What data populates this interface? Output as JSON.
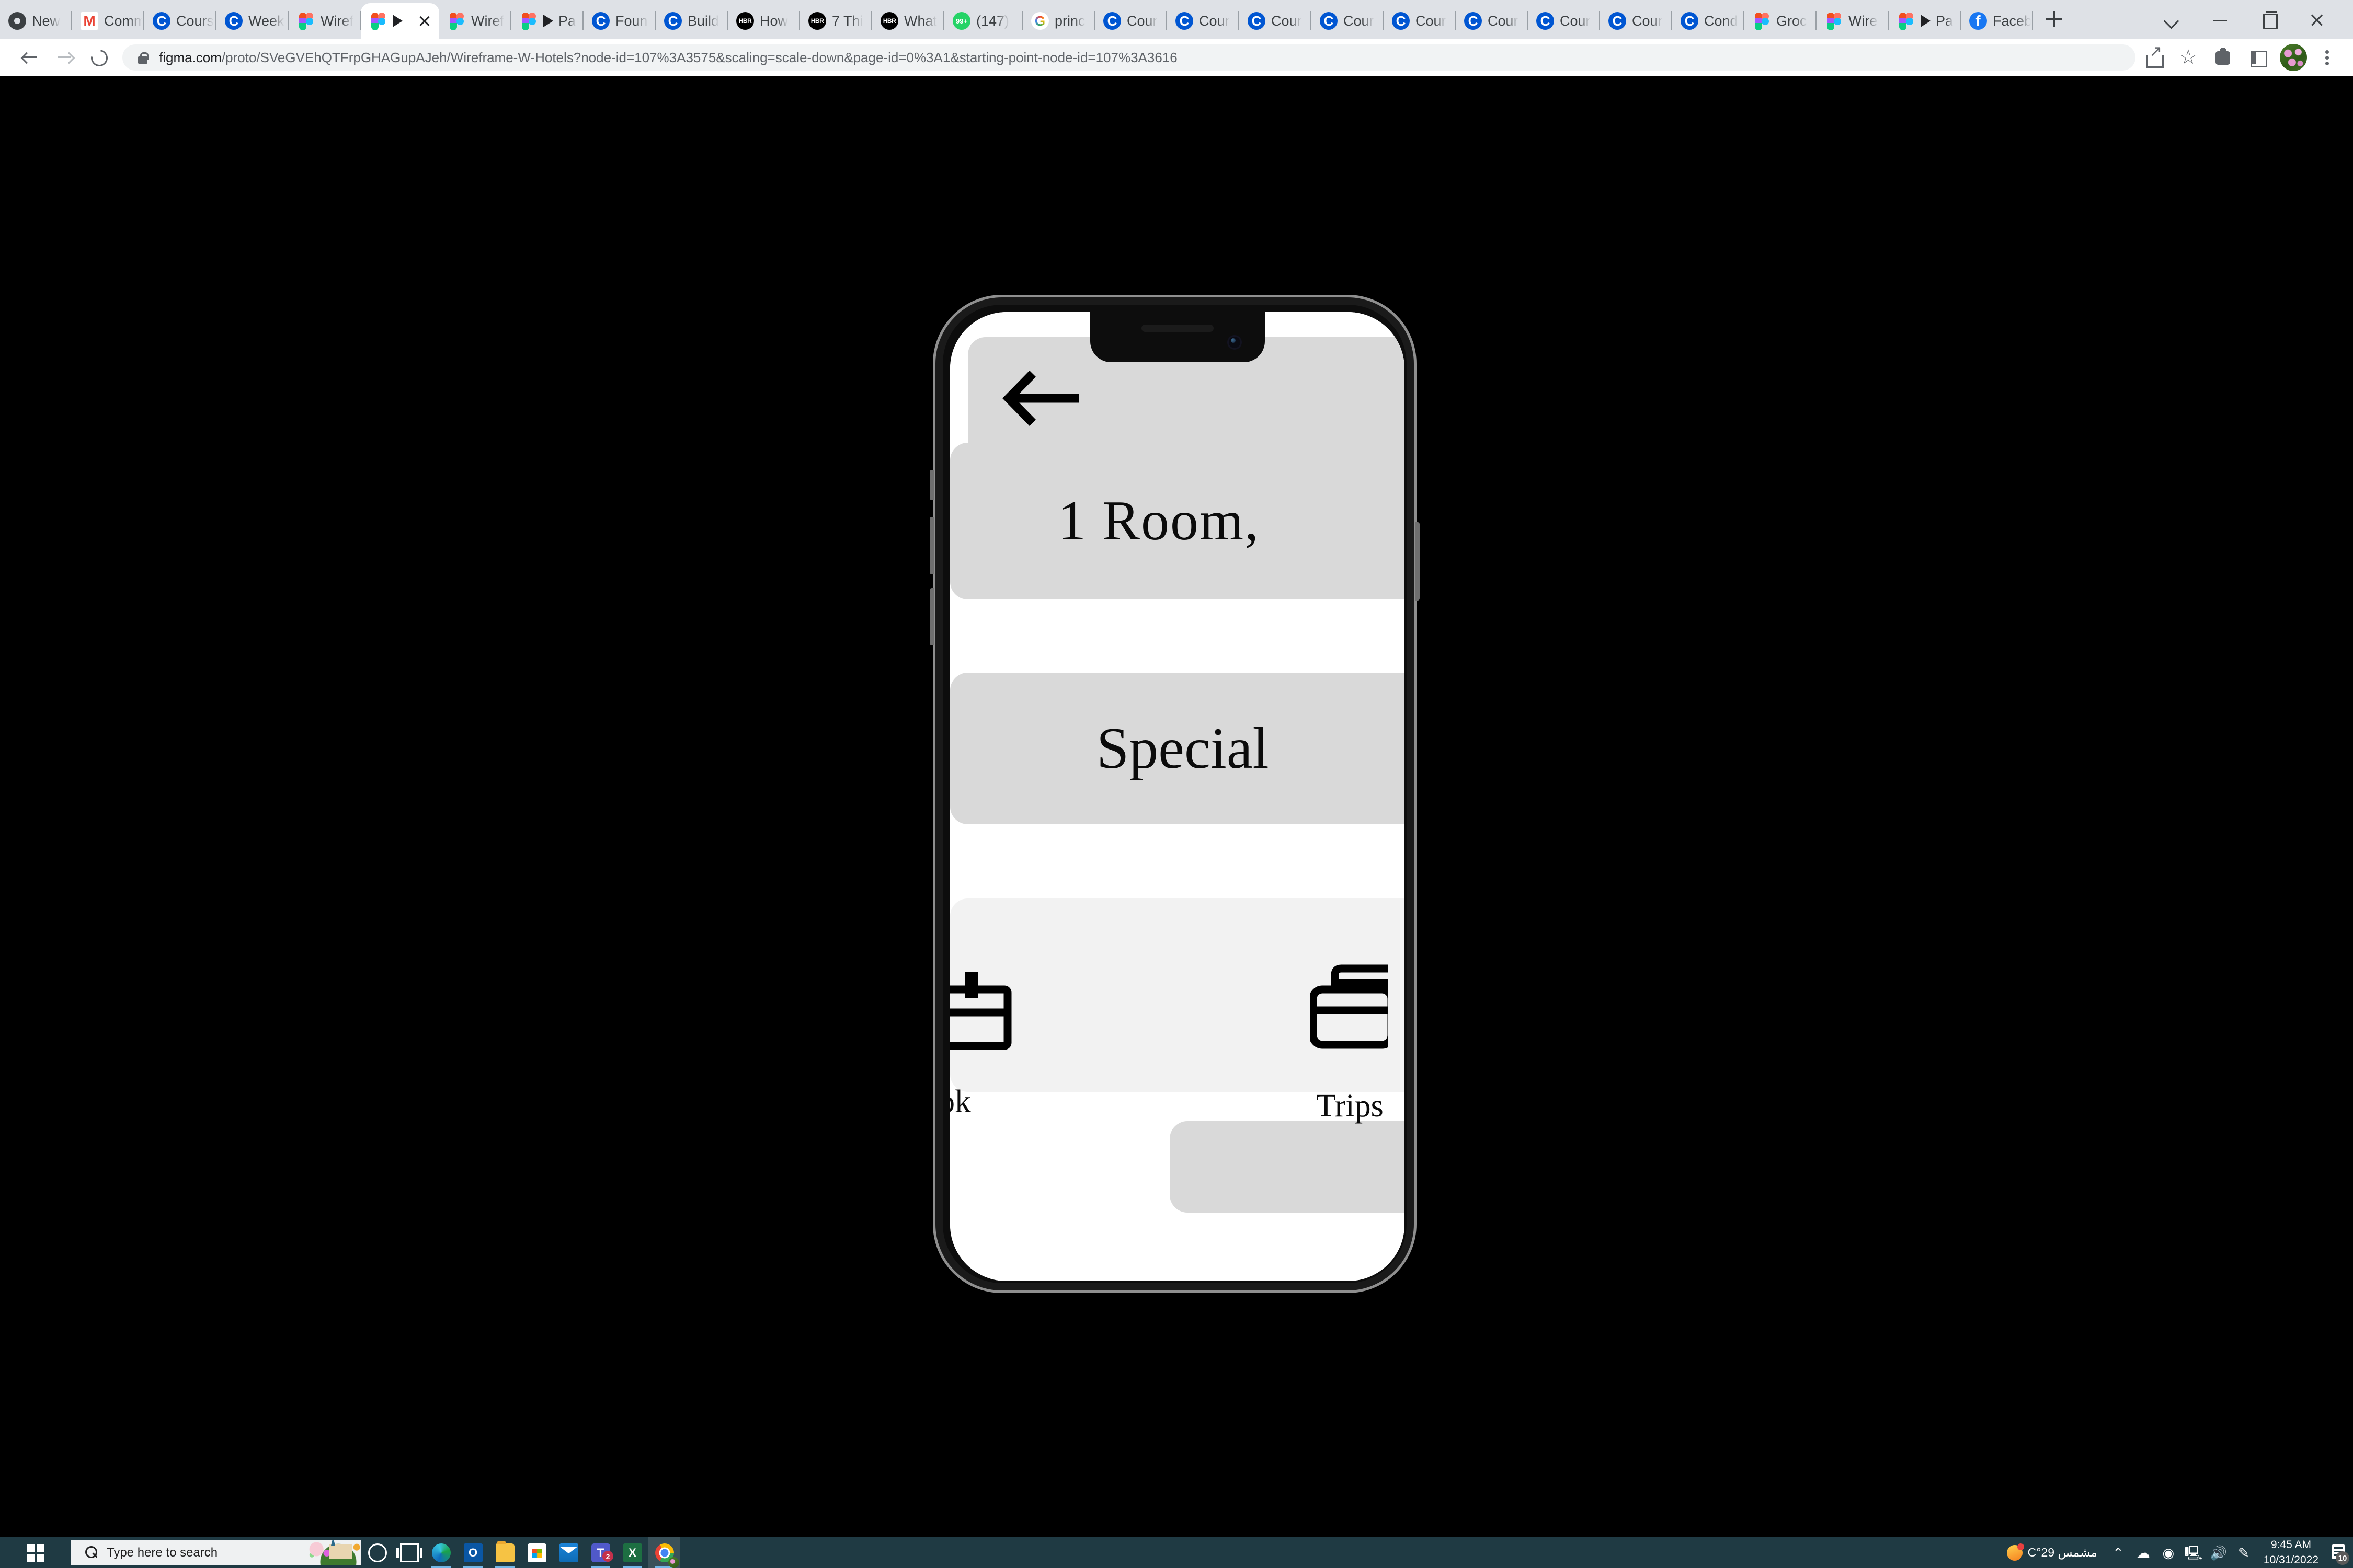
{
  "browser": {
    "tabs": [
      {
        "icon": "chrome-grey-icon",
        "label": "New"
      },
      {
        "icon": "gmail-icon",
        "label": "Comm"
      },
      {
        "icon": "coursera-icon",
        "label": "Cours"
      },
      {
        "icon": "coursera-icon",
        "label": "Week"
      },
      {
        "icon": "figma-icon",
        "label": "Wiref"
      },
      {
        "icon": "figma-icon",
        "label": "",
        "active": true,
        "has_play": true,
        "has_close": true
      },
      {
        "icon": "figma-icon",
        "label": "Wiref"
      },
      {
        "icon": "figma-icon",
        "label": "Pa",
        "has_play": true
      },
      {
        "icon": "coursera-icon",
        "label": "Foun"
      },
      {
        "icon": "coursera-icon",
        "label": "Build"
      },
      {
        "icon": "hbr-icon",
        "label": "How"
      },
      {
        "icon": "hbr-icon",
        "label": "7 Thi"
      },
      {
        "icon": "hbr-icon",
        "label": "What"
      },
      {
        "icon": "whatsapp-icon",
        "label": "(147)"
      },
      {
        "icon": "google-icon",
        "label": "princ"
      },
      {
        "icon": "coursera-icon",
        "label": "Cour"
      },
      {
        "icon": "coursera-icon",
        "label": "Cour"
      },
      {
        "icon": "coursera-icon",
        "label": "Cour"
      },
      {
        "icon": "coursera-icon",
        "label": "Cour"
      },
      {
        "icon": "coursera-icon",
        "label": "Cour"
      },
      {
        "icon": "coursera-icon",
        "label": "Cour"
      },
      {
        "icon": "coursera-icon",
        "label": "Cour"
      },
      {
        "icon": "coursera-icon",
        "label": "Cour"
      },
      {
        "icon": "coursera-icon",
        "label": "Cond"
      },
      {
        "icon": "figma-icon",
        "label": "Groc"
      },
      {
        "icon": "figma-icon",
        "label": "Wire"
      },
      {
        "icon": "figma-icon",
        "label": "Pa",
        "has_play": true
      },
      {
        "icon": "facebook-icon",
        "label": "Faceb"
      }
    ],
    "url_domain": "figma.com",
    "url_path": "/proto/SVeGVEhQTFrpGHAGupAJeh/Wireframe-W-Hotels?node-id=107%3A3575&scaling=scale-down&page-id=0%3A1&starting-point-node-id=107%3A3616",
    "toolbar_icons": [
      "back-icon",
      "forward-icon",
      "reload-icon",
      "lock-icon",
      "share-icon",
      "bookmark-star-icon",
      "extensions-puzzle-icon",
      "sidebar-icon",
      "profile-avatar",
      "three-dot-menu-icon"
    ],
    "window_controls": [
      "chevron-down-icon",
      "minimize-icon",
      "maximize-icon",
      "close-icon"
    ]
  },
  "prototype": {
    "back_arrow": "back-arrow-icon",
    "title": "1  Room,",
    "section_title": "Special",
    "nav": [
      {
        "icon": "briefcase-icon",
        "label": "ok"
      },
      {
        "icon": "briefcase-icon",
        "label": "Trips"
      }
    ]
  },
  "taskbar": {
    "start": "windows-logo",
    "search_placeholder": "Type here to search",
    "apps": [
      {
        "name": "cortana-icon"
      },
      {
        "name": "task-view-icon"
      },
      {
        "name": "edge-icon"
      },
      {
        "name": "outlook-icon"
      },
      {
        "name": "file-explorer-icon"
      },
      {
        "name": "microsoft-store-icon"
      },
      {
        "name": "mail-icon"
      },
      {
        "name": "teams-icon",
        "badge": "2"
      },
      {
        "name": "excel-icon"
      },
      {
        "name": "chrome-icon"
      }
    ],
    "weather_temp": "29°C",
    "weather_desc": "مشمس",
    "tray_icons": [
      "show-hidden-icons-chevron",
      "onedrive-icon",
      "skype-icon",
      "network-icon",
      "volume-icon",
      "pen-icon"
    ],
    "time": "9:45 AM",
    "date": "10/31/2022",
    "notification_count": "10"
  },
  "colors": {
    "chrome_tabstrip": "#dee1e6",
    "toolbar": "#ffffff",
    "viewport_bg": "#000000",
    "taskbar": "#1f3a43",
    "card_grey": "#d9d9d9",
    "panel_light": "#f2f2f2"
  }
}
